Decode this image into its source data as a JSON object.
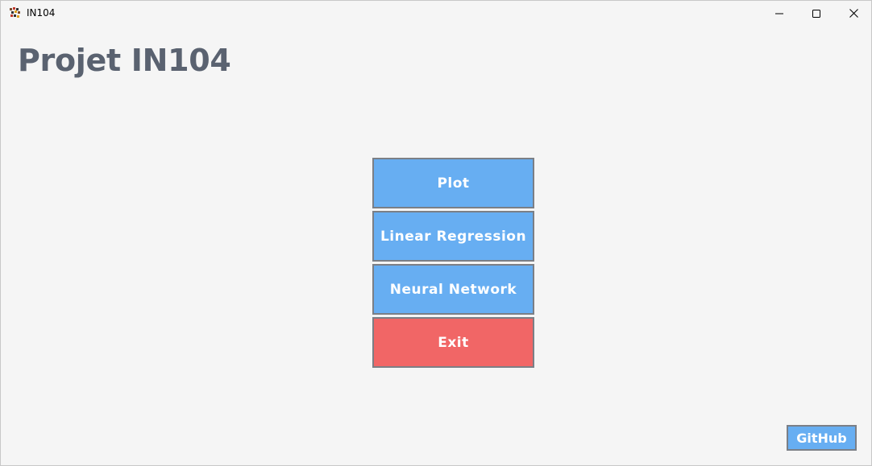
{
  "window": {
    "title": "IN104"
  },
  "window_controls": {
    "minimize_icon": "minimize-icon",
    "maximize_icon": "maximize-icon",
    "close_icon": "close-icon"
  },
  "main": {
    "title": "Projet IN104",
    "buttons": [
      {
        "label": "Plot",
        "color": "#67aef2"
      },
      {
        "label": "Linear Regression",
        "color": "#67aef2"
      },
      {
        "label": "Neural Network",
        "color": "#67aef2"
      },
      {
        "label": "Exit",
        "color": "#f16666"
      }
    ]
  },
  "footer": {
    "github_label": "GitHub"
  },
  "colors": {
    "background": "#f5f5f5",
    "title_text": "#5a6270",
    "primary_button": "#67aef2",
    "danger_button": "#f16666",
    "button_border": "#7b7f86"
  }
}
